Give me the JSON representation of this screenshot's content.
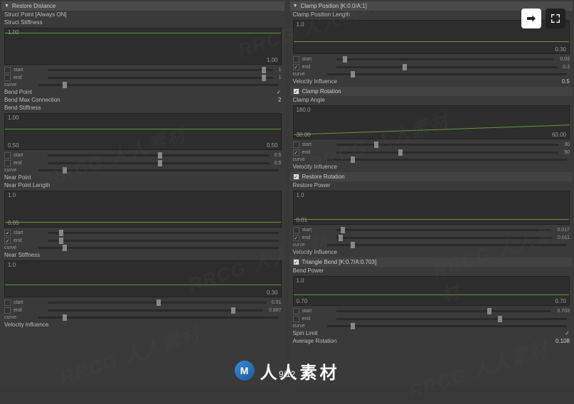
{
  "page_indicator": "9/12",
  "footer_brand": "人人素材",
  "watermark_text": "RRCG 人人素材",
  "left": {
    "header": "Restore Distance",
    "struct_point_label": "Struct Point [Always ON]",
    "struct_stiffness_label": "Struct Stiffness",
    "bend_point_label": "Bend Point",
    "bend_max_label": "Bend Max Connection",
    "bend_max_val": "2",
    "bend_stiffness_label": "Bend Stiffness",
    "near_point_label": "Near Point",
    "near_length_label": "Near Point Length",
    "near_stiffness_label": "Near Stiffness",
    "velocity_label": "Velocity Influence",
    "curve1": {
      "top": "1.00",
      "bot": "1.00"
    },
    "se1": {
      "start": "start",
      "start_v": "1",
      "end": "end",
      "end_v": "1",
      "curve": "curve"
    },
    "curve2": {
      "top": "1.00",
      "bot": "0.50"
    },
    "se2": {
      "start": "start",
      "start_v": "0.5",
      "end": "end",
      "end_v": "0.5",
      "curve": "curve"
    },
    "curve3": {
      "top": "1.0",
      "bot": "0.05"
    },
    "se3": {
      "start": "start",
      "end": "end",
      "curve": "curve"
    },
    "curve4": {
      "top": "1.0",
      "bot": "0.30"
    },
    "se4": {
      "start": "start",
      "start_v": "0.51",
      "end": "end",
      "end_v": "0.887",
      "curve": "curve"
    }
  },
  "right": {
    "header": "Clamp Position [K:0.0/A:1]",
    "clamp_pos_len_label": "Clamp Position Length",
    "curve1": {
      "top": "1.0",
      "bot": "0.30"
    },
    "se1": {
      "start": "start",
      "start_v": "0.03",
      "end": "end",
      "end_v": "0.3",
      "curve": "curve"
    },
    "vel_inf_label": "Velocity Influence",
    "vel_inf_val": "0.5",
    "clamp_rot_sub": "Clamp Rotation",
    "clamp_angle_label": "Clamp Angle",
    "curve2": {
      "left": "30.00",
      "right": "60.00",
      "top": "180.0"
    },
    "se2": {
      "start": "start",
      "start_v": "30",
      "end": "end",
      "end_v": "50",
      "curve": "curve"
    },
    "vel_inf2_label": "Velocity Influence",
    "restore_rot_sub": "Restore Rotation",
    "restore_power_label": "Restore Power",
    "curve3": {
      "top": "1.0",
      "bot": "0.01"
    },
    "se3": {
      "start": "start",
      "start_v": "0.017",
      "end": "end",
      "end_v": "0.011",
      "curve": "curve"
    },
    "vel_inf3_label": "Velocity Influence",
    "triangle_sub": "Triangle Bend [K:0.7/A:0.703]",
    "bend_power_label": "Bend Power",
    "curve4": {
      "top": "1.0",
      "left": "0.70",
      "right": "0.70"
    },
    "se4": {
      "start": "start",
      "start_v": "0.703",
      "end": "end",
      "curve": "curve"
    },
    "spin_label": "Spin Limit",
    "avg_label": "Average Rotation",
    "spin_val": "0.108"
  },
  "chart_data": [
    {
      "type": "line",
      "title": "Struct Stiffness",
      "x": [
        0,
        1
      ],
      "values": [
        1.0,
        1.0
      ],
      "ylim": [
        0,
        1
      ]
    },
    {
      "type": "line",
      "title": "Bend Stiffness",
      "x": [
        0,
        1
      ],
      "values": [
        0.5,
        0.5
      ],
      "ylim": [
        0,
        1
      ]
    },
    {
      "type": "line",
      "title": "Near Point Length",
      "x": [
        0,
        1
      ],
      "values": [
        0.05,
        0.05
      ],
      "ylim": [
        0,
        1
      ]
    },
    {
      "type": "line",
      "title": "Near Stiffness",
      "x": [
        0,
        1
      ],
      "values": [
        0.3,
        0.3
      ],
      "ylim": [
        0,
        1
      ]
    },
    {
      "type": "line",
      "title": "Clamp Position Length",
      "x": [
        0,
        1
      ],
      "values": [
        0.3,
        0.3
      ],
      "ylim": [
        0,
        1
      ]
    },
    {
      "type": "line",
      "title": "Clamp Angle",
      "x": [
        0,
        1
      ],
      "values": [
        30,
        60
      ],
      "ylim": [
        0,
        180
      ]
    },
    {
      "type": "line",
      "title": "Restore Power",
      "x": [
        0,
        1
      ],
      "values": [
        0.01,
        0.01
      ],
      "ylim": [
        0,
        1
      ]
    },
    {
      "type": "line",
      "title": "Bend Power",
      "x": [
        0,
        1
      ],
      "values": [
        0.7,
        0.7
      ],
      "ylim": [
        0,
        1
      ]
    }
  ]
}
